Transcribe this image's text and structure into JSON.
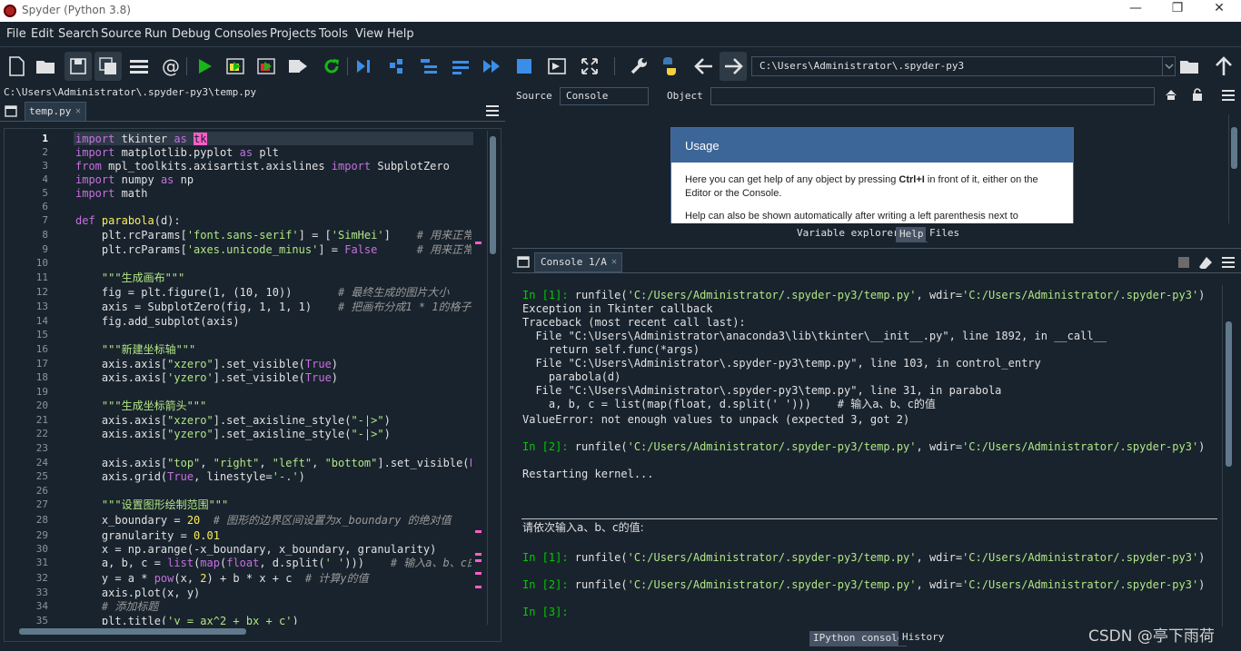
{
  "window": {
    "title": "Spyder (Python 3.8)"
  },
  "menu": [
    "File",
    "Edit",
    "Search",
    "Source",
    "Run",
    "Debug",
    "Consoles",
    "Projects",
    "Tools",
    "View",
    "Help"
  ],
  "toolbar": {
    "working_dir": "C:\\Users\\Administrator\\.spyder-py3"
  },
  "editor": {
    "path": "C:\\Users\\Administrator\\.spyder-py3\\temp.py",
    "tab": "temp.py",
    "current_line": 1,
    "line_numbers": [
      "1",
      "2",
      "3",
      "4",
      "5",
      "6",
      "7",
      "8",
      "9",
      "10",
      "11",
      "12",
      "13",
      "14",
      "15",
      "16",
      "17",
      "18",
      "19",
      "20",
      "21",
      "22",
      "23",
      "24",
      "25",
      "26",
      "27",
      "28",
      "29",
      "30",
      "31",
      "32",
      "33",
      "34",
      "35"
    ]
  },
  "help": {
    "source_label": "Source",
    "source_value": "Console",
    "object_label": "Object",
    "usage_title": "Usage",
    "usage_text1a": "Here you can get help of any object by pressing ",
    "usage_text1b": "Ctrl+I",
    "usage_text1c": " in front of it, either on the Editor or the Console.",
    "usage_text2": "Help can also be shown automatically after writing a left parenthesis next to",
    "tabs": [
      "Variable explorer",
      "Help",
      "Files"
    ]
  },
  "console": {
    "tab": "Console 1/A",
    "bottom_tabs": [
      "IPython console",
      "History"
    ]
  },
  "watermark": "CSDN @亭下雨荷"
}
